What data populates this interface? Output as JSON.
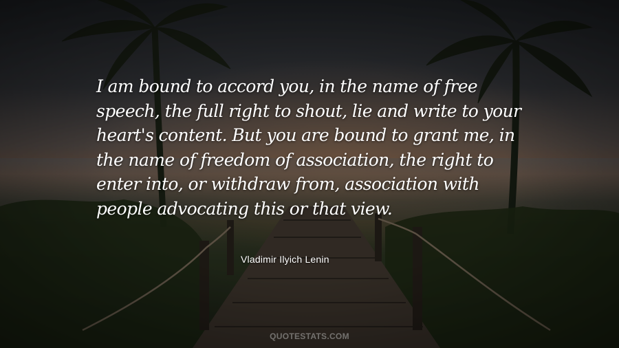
{
  "quote": {
    "lines": [
      "I am bound to accord you, in the name of free",
      "speech, the full right to shout, lie and write to your",
      "heart's content. But you are bound to grant me, in",
      "the name of freedom of association, the right to",
      "enter into, or withdraw from, association with",
      "people advocating this or that view."
    ],
    "author": "Vladimir Ilyich Lenin"
  },
  "watermark": "QUOTESTATS.COM",
  "colors": {
    "text": "#ffffff",
    "watermark": "#d2d2d2"
  }
}
